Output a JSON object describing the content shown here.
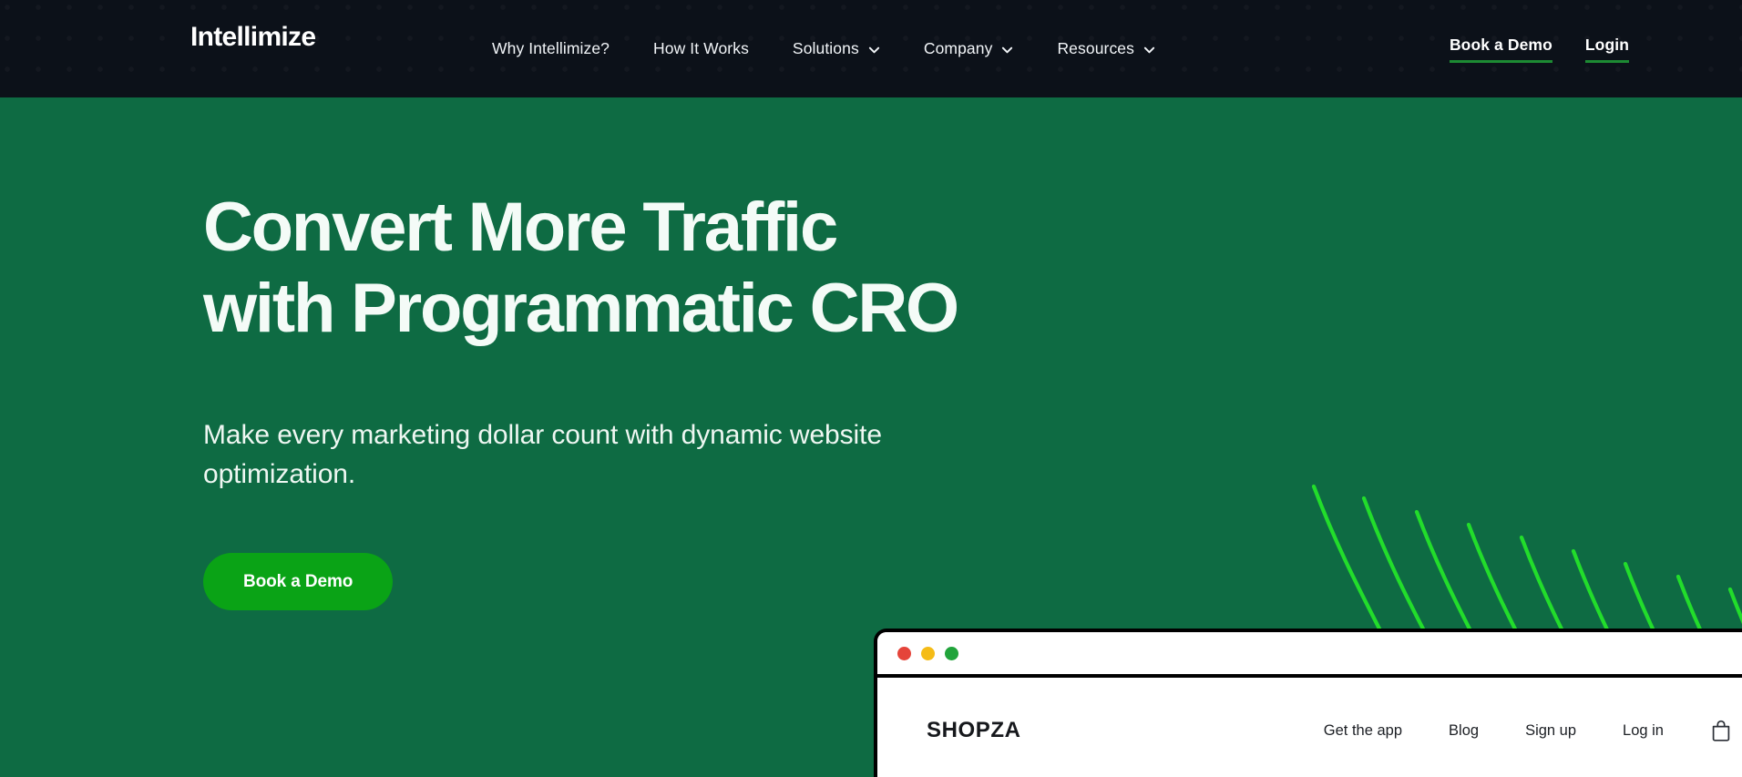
{
  "colors": {
    "nav_bg": "#0c1119",
    "hero_green": "#0e6b43",
    "accent_green": "#0aa316",
    "underline_green": "#1d8a33",
    "deco_line_green": "#22dd2b",
    "heading_white": "#f4fbf7"
  },
  "navbar": {
    "logo": "Intellimize",
    "links": [
      {
        "label": "Why Intellimize?",
        "has_chevron": false,
        "icon": ""
      },
      {
        "label": "How It Works",
        "has_chevron": false,
        "icon": ""
      },
      {
        "label": "Solutions",
        "has_chevron": true,
        "icon": "chevron-down-icon"
      },
      {
        "label": "Company",
        "has_chevron": true,
        "icon": "chevron-down-icon"
      },
      {
        "label": "Resources",
        "has_chevron": true,
        "icon": "chevron-down-icon"
      }
    ],
    "actions": [
      {
        "label": "Book a Demo"
      },
      {
        "label": "Login"
      }
    ]
  },
  "hero": {
    "title_line1": "Convert More Traffic",
    "title_line2": "with Programmatic CRO",
    "subtitle": "Make every marketing dollar count with dynamic website optimization.",
    "cta_label": "Book a Demo"
  },
  "mockup": {
    "window_controls": [
      {
        "name": "close",
        "color": "#e5443a"
      },
      {
        "name": "minimize",
        "color": "#f5bc17"
      },
      {
        "name": "maximize",
        "color": "#21a43b"
      }
    ],
    "site_logo": "SHOPZA",
    "site_links": [
      {
        "label": "Get the app"
      },
      {
        "label": "Blog"
      },
      {
        "label": "Sign up"
      },
      {
        "label": "Log in"
      }
    ],
    "cart_icon": "shopping-bag-icon"
  }
}
